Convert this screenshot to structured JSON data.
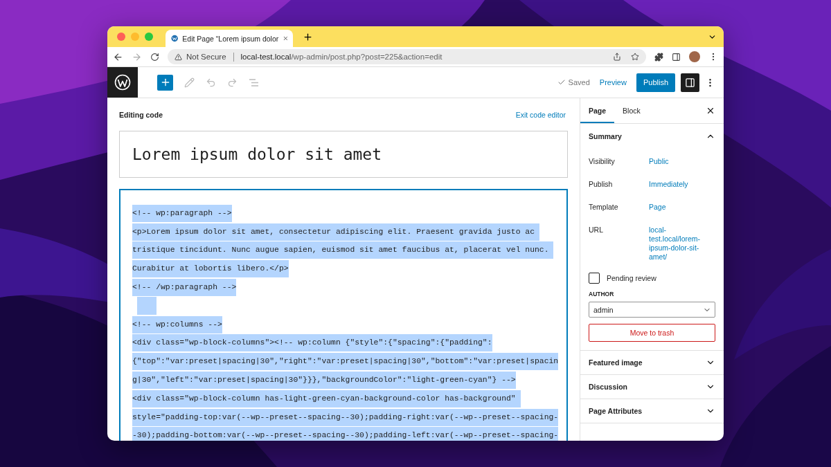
{
  "browser": {
    "tab_title": "Edit Page “Lorem ipsum dolor",
    "security": "Not Secure",
    "url_host": "local-test.local",
    "url_path": "/wp-admin/post.php?post=225&action=edit"
  },
  "toolbar": {
    "saved": "Saved",
    "preview": "Preview",
    "publish": "Publish",
    "settings_open": true
  },
  "editor": {
    "heading": "Editing code",
    "exit": "Exit code editor",
    "title": "Lorem ipsum dolor sit amet",
    "code_lines": [
      {
        "kind": "text",
        "text": "<!-- wp:paragraph -->"
      },
      {
        "kind": "text",
        "text": "<p>Lorem ipsum dolor sit amet, consectetur adipiscing elit. Praesent gravida justo ac "
      },
      {
        "kind": "text",
        "text": "tristique tincidunt. Nunc augue sapien, euismod sit amet faucibus at, placerat vel nunc. "
      },
      {
        "kind": "text",
        "text": "Curabitur at lobortis libero.</p>"
      },
      {
        "kind": "text",
        "text": "<!-- /wp:paragraph -->"
      },
      {
        "kind": "blank"
      },
      {
        "kind": "text",
        "text": "<!-- wp:columns -->"
      },
      {
        "kind": "text",
        "text": "<div class=\"wp-block-columns\"><!-- wp:column {\"style\":{\"spacing\":{\"padding\":"
      },
      {
        "kind": "text",
        "text": "{\"top\":\"var:preset|spacing|30\",\"right\":\"var:preset|spacing|30\",\"bottom\":\"var:preset|spacin"
      },
      {
        "kind": "text",
        "text": "g|30\",\"left\":\"var:preset|spacing|30\"}}},\"backgroundColor\":\"light-green-cyan\"} -->"
      },
      {
        "kind": "text",
        "text": "<div class=\"wp-block-column has-light-green-cyan-background-color has-background\" "
      },
      {
        "kind": "text",
        "text": "style=\"padding-top:var(--wp--preset--spacing--30);padding-right:var(--wp--preset--spacing-"
      },
      {
        "kind": "text",
        "text": "-30);padding-bottom:var(--wp--preset--spacing--30);padding-left:var(--wp--preset--spacing-"
      }
    ]
  },
  "sidebar": {
    "tabs": [
      {
        "label": "Page",
        "selected": true
      },
      {
        "label": "Block",
        "selected": false
      }
    ],
    "summary": {
      "title": "Summary",
      "expanded": true,
      "rows": [
        {
          "label": "Visibility",
          "value": "Public"
        },
        {
          "label": "Publish",
          "value": "Immediately"
        },
        {
          "label": "Template",
          "value": "Page"
        },
        {
          "label": "URL",
          "value": "local-test.local/lorem-ipsum-dolor-sit-amet/"
        }
      ]
    },
    "pending_review": {
      "label": "Pending review",
      "checked": false
    },
    "author": {
      "label": "AUTHOR",
      "value": "admin"
    },
    "trash": "Move to trash",
    "panels": [
      {
        "title": "Featured image",
        "expanded": false
      },
      {
        "title": "Discussion",
        "expanded": false
      },
      {
        "title": "Page Attributes",
        "expanded": false
      }
    ]
  }
}
